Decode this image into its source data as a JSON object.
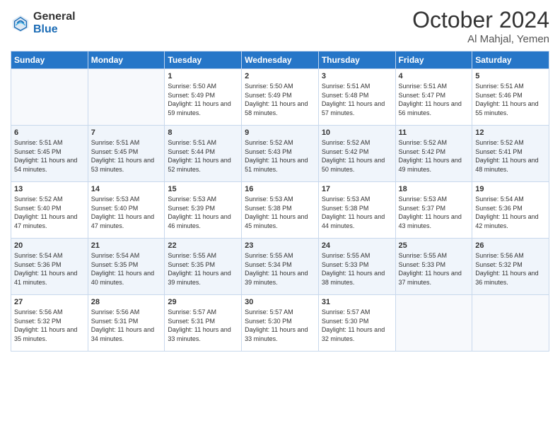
{
  "header": {
    "logo_general": "General",
    "logo_blue": "Blue",
    "month": "October 2024",
    "location": "Al Mahjal, Yemen"
  },
  "days_of_week": [
    "Sunday",
    "Monday",
    "Tuesday",
    "Wednesday",
    "Thursday",
    "Friday",
    "Saturday"
  ],
  "weeks": [
    [
      {
        "day": "",
        "sunrise": "",
        "sunset": "",
        "daylight": ""
      },
      {
        "day": "",
        "sunrise": "",
        "sunset": "",
        "daylight": ""
      },
      {
        "day": "1",
        "sunrise": "Sunrise: 5:50 AM",
        "sunset": "Sunset: 5:49 PM",
        "daylight": "Daylight: 11 hours and 59 minutes."
      },
      {
        "day": "2",
        "sunrise": "Sunrise: 5:50 AM",
        "sunset": "Sunset: 5:49 PM",
        "daylight": "Daylight: 11 hours and 58 minutes."
      },
      {
        "day": "3",
        "sunrise": "Sunrise: 5:51 AM",
        "sunset": "Sunset: 5:48 PM",
        "daylight": "Daylight: 11 hours and 57 minutes."
      },
      {
        "day": "4",
        "sunrise": "Sunrise: 5:51 AM",
        "sunset": "Sunset: 5:47 PM",
        "daylight": "Daylight: 11 hours and 56 minutes."
      },
      {
        "day": "5",
        "sunrise": "Sunrise: 5:51 AM",
        "sunset": "Sunset: 5:46 PM",
        "daylight": "Daylight: 11 hours and 55 minutes."
      }
    ],
    [
      {
        "day": "6",
        "sunrise": "Sunrise: 5:51 AM",
        "sunset": "Sunset: 5:45 PM",
        "daylight": "Daylight: 11 hours and 54 minutes."
      },
      {
        "day": "7",
        "sunrise": "Sunrise: 5:51 AM",
        "sunset": "Sunset: 5:45 PM",
        "daylight": "Daylight: 11 hours and 53 minutes."
      },
      {
        "day": "8",
        "sunrise": "Sunrise: 5:51 AM",
        "sunset": "Sunset: 5:44 PM",
        "daylight": "Daylight: 11 hours and 52 minutes."
      },
      {
        "day": "9",
        "sunrise": "Sunrise: 5:52 AM",
        "sunset": "Sunset: 5:43 PM",
        "daylight": "Daylight: 11 hours and 51 minutes."
      },
      {
        "day": "10",
        "sunrise": "Sunrise: 5:52 AM",
        "sunset": "Sunset: 5:42 PM",
        "daylight": "Daylight: 11 hours and 50 minutes."
      },
      {
        "day": "11",
        "sunrise": "Sunrise: 5:52 AM",
        "sunset": "Sunset: 5:42 PM",
        "daylight": "Daylight: 11 hours and 49 minutes."
      },
      {
        "day": "12",
        "sunrise": "Sunrise: 5:52 AM",
        "sunset": "Sunset: 5:41 PM",
        "daylight": "Daylight: 11 hours and 48 minutes."
      }
    ],
    [
      {
        "day": "13",
        "sunrise": "Sunrise: 5:52 AM",
        "sunset": "Sunset: 5:40 PM",
        "daylight": "Daylight: 11 hours and 47 minutes."
      },
      {
        "day": "14",
        "sunrise": "Sunrise: 5:53 AM",
        "sunset": "Sunset: 5:40 PM",
        "daylight": "Daylight: 11 hours and 47 minutes."
      },
      {
        "day": "15",
        "sunrise": "Sunrise: 5:53 AM",
        "sunset": "Sunset: 5:39 PM",
        "daylight": "Daylight: 11 hours and 46 minutes."
      },
      {
        "day": "16",
        "sunrise": "Sunrise: 5:53 AM",
        "sunset": "Sunset: 5:38 PM",
        "daylight": "Daylight: 11 hours and 45 minutes."
      },
      {
        "day": "17",
        "sunrise": "Sunrise: 5:53 AM",
        "sunset": "Sunset: 5:38 PM",
        "daylight": "Daylight: 11 hours and 44 minutes."
      },
      {
        "day": "18",
        "sunrise": "Sunrise: 5:53 AM",
        "sunset": "Sunset: 5:37 PM",
        "daylight": "Daylight: 11 hours and 43 minutes."
      },
      {
        "day": "19",
        "sunrise": "Sunrise: 5:54 AM",
        "sunset": "Sunset: 5:36 PM",
        "daylight": "Daylight: 11 hours and 42 minutes."
      }
    ],
    [
      {
        "day": "20",
        "sunrise": "Sunrise: 5:54 AM",
        "sunset": "Sunset: 5:36 PM",
        "daylight": "Daylight: 11 hours and 41 minutes."
      },
      {
        "day": "21",
        "sunrise": "Sunrise: 5:54 AM",
        "sunset": "Sunset: 5:35 PM",
        "daylight": "Daylight: 11 hours and 40 minutes."
      },
      {
        "day": "22",
        "sunrise": "Sunrise: 5:55 AM",
        "sunset": "Sunset: 5:35 PM",
        "daylight": "Daylight: 11 hours and 39 minutes."
      },
      {
        "day": "23",
        "sunrise": "Sunrise: 5:55 AM",
        "sunset": "Sunset: 5:34 PM",
        "daylight": "Daylight: 11 hours and 39 minutes."
      },
      {
        "day": "24",
        "sunrise": "Sunrise: 5:55 AM",
        "sunset": "Sunset: 5:33 PM",
        "daylight": "Daylight: 11 hours and 38 minutes."
      },
      {
        "day": "25",
        "sunrise": "Sunrise: 5:55 AM",
        "sunset": "Sunset: 5:33 PM",
        "daylight": "Daylight: 11 hours and 37 minutes."
      },
      {
        "day": "26",
        "sunrise": "Sunrise: 5:56 AM",
        "sunset": "Sunset: 5:32 PM",
        "daylight": "Daylight: 11 hours and 36 minutes."
      }
    ],
    [
      {
        "day": "27",
        "sunrise": "Sunrise: 5:56 AM",
        "sunset": "Sunset: 5:32 PM",
        "daylight": "Daylight: 11 hours and 35 minutes."
      },
      {
        "day": "28",
        "sunrise": "Sunrise: 5:56 AM",
        "sunset": "Sunset: 5:31 PM",
        "daylight": "Daylight: 11 hours and 34 minutes."
      },
      {
        "day": "29",
        "sunrise": "Sunrise: 5:57 AM",
        "sunset": "Sunset: 5:31 PM",
        "daylight": "Daylight: 11 hours and 33 minutes."
      },
      {
        "day": "30",
        "sunrise": "Sunrise: 5:57 AM",
        "sunset": "Sunset: 5:30 PM",
        "daylight": "Daylight: 11 hours and 33 minutes."
      },
      {
        "day": "31",
        "sunrise": "Sunrise: 5:57 AM",
        "sunset": "Sunset: 5:30 PM",
        "daylight": "Daylight: 11 hours and 32 minutes."
      },
      {
        "day": "",
        "sunrise": "",
        "sunset": "",
        "daylight": ""
      },
      {
        "day": "",
        "sunrise": "",
        "sunset": "",
        "daylight": ""
      }
    ]
  ]
}
